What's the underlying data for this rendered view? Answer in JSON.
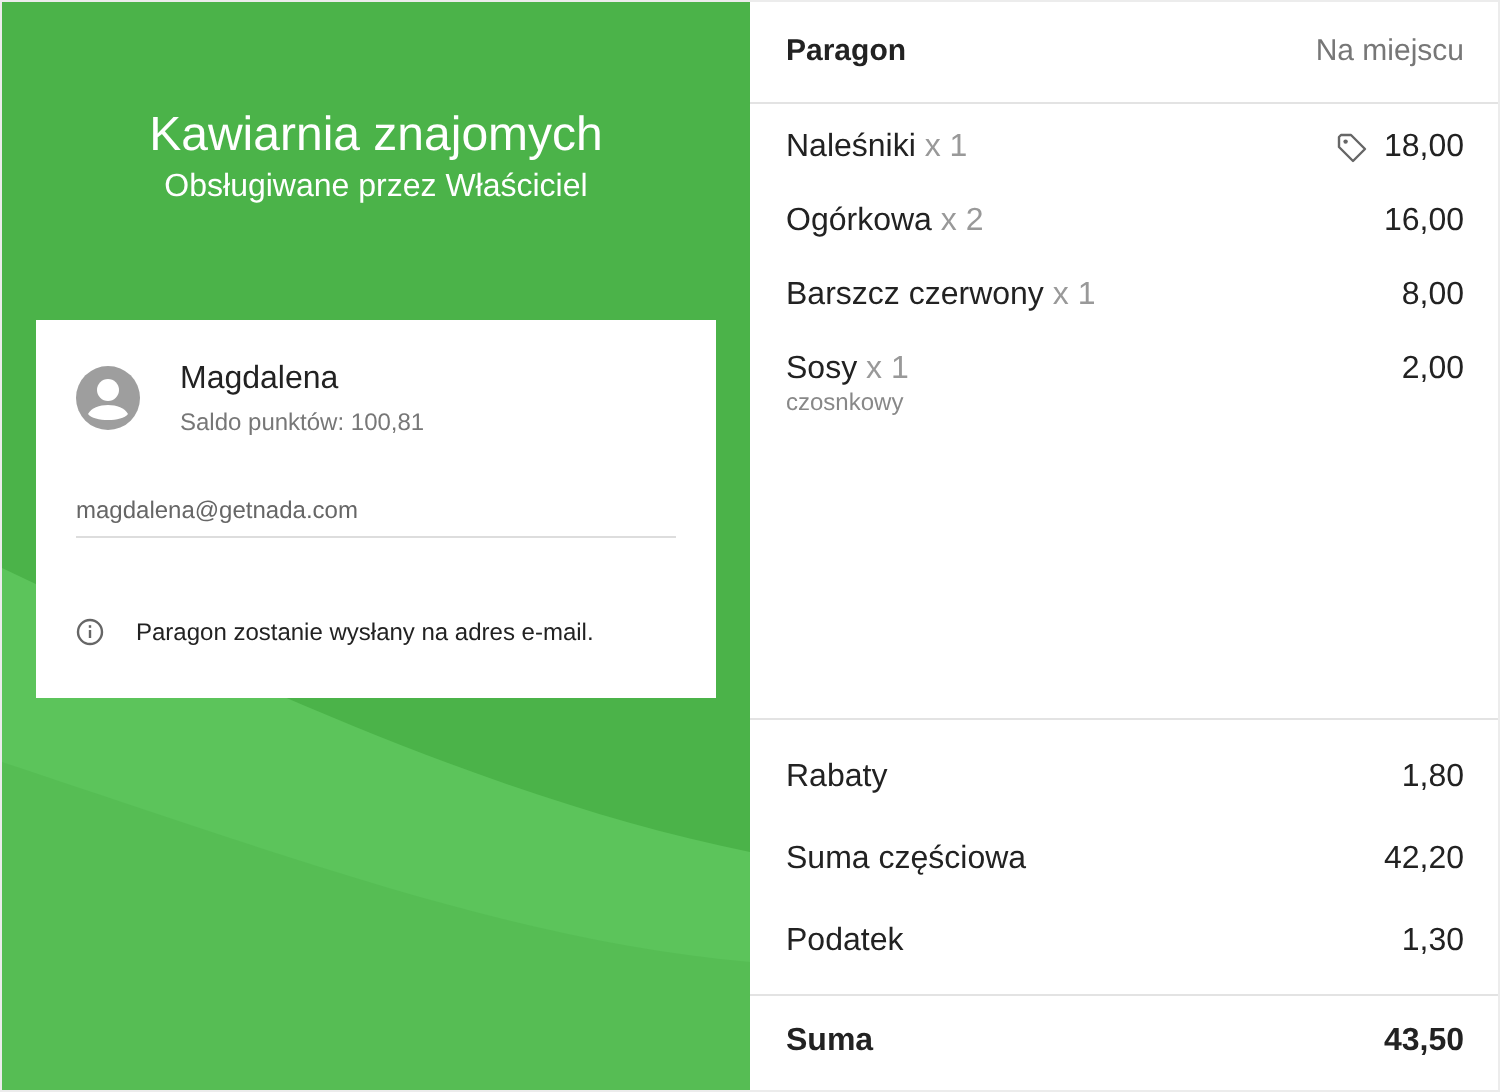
{
  "store": {
    "name": "Kawiarnia znajomych",
    "served_by": "Obsługiwane przez Właściciel"
  },
  "customer": {
    "name": "Magdalena",
    "points": "Saldo punktów: 100,81",
    "email": "magdalena@getnada.com",
    "notice": "Paragon zostanie wysłany na adres e-mail."
  },
  "receipt": {
    "title": "Paragon",
    "order_type": "Na miejscu",
    "items": [
      {
        "name": "Naleśniki",
        "quantity": "x 1",
        "price": "18,00",
        "discounted": true
      },
      {
        "name": "Ogórkowa",
        "quantity": "x 2",
        "price": "16,00",
        "discounted": false
      },
      {
        "name": "Barszcz czerwony",
        "quantity": "x 1",
        "price": "8,00",
        "discounted": false
      },
      {
        "name": "Sosy",
        "quantity": "x 1",
        "price": "2,00",
        "discounted": false,
        "note": "czosnkowy"
      }
    ],
    "summary": [
      {
        "label": "Rabaty",
        "value": "1,80"
      },
      {
        "label": "Suma częściowa",
        "value": "42,20"
      },
      {
        "label": "Podatek",
        "value": "1,30"
      }
    ],
    "total": {
      "label": "Suma",
      "value": "43,50"
    }
  }
}
